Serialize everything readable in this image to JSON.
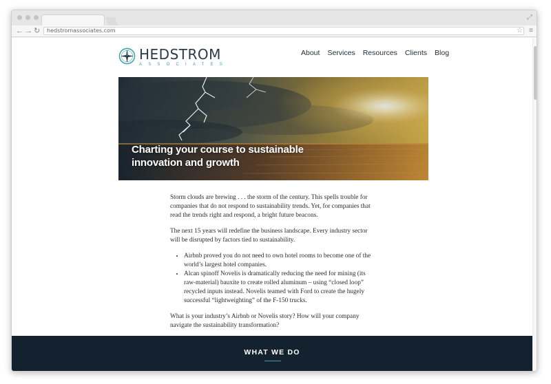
{
  "browser": {
    "url": "hedstromassociates.com"
  },
  "site": {
    "logo_name": "HEDSTROM",
    "logo_sub": "ASSOCIATES",
    "nav": [
      "About",
      "Services",
      "Resources",
      "Clients",
      "Blog"
    ]
  },
  "hero": {
    "title_line1": "Charting your course to sustainable",
    "title_line2": "innovation and growth"
  },
  "article": {
    "p1": "Storm clouds are brewing . . . the storm of the century. This spells trouble for companies that do not respond to sustainability trends. Yet, for companies that read the trends right and respond, a bright future beacons.",
    "p2": "The next 15 years will redefine the business landscape. Every industry sector will be disrupted by factors tied to sustainability.",
    "bullets": [
      "Airbnb proved you do not need to own hotel rooms to become one of the world’s largest hotel companies.",
      "Alcan spinoff Novelis is dramatically reducing the need for mining (its raw-material) bauxite to create rolled aluminum – using “closed loop” recycled inputs instead. Novelis teamed with Ford to create the hugely successful “lightweighting” of the F-150 trucks."
    ],
    "p3": "What is your industry’s Airbnb or Novelis story? How will your company navigate the sustainability transformation?"
  },
  "section": {
    "title": "WHAT WE DO"
  },
  "colors": {
    "band": "#13222e",
    "accent": "#39a3a3",
    "logo_text": "#2a3a48"
  }
}
